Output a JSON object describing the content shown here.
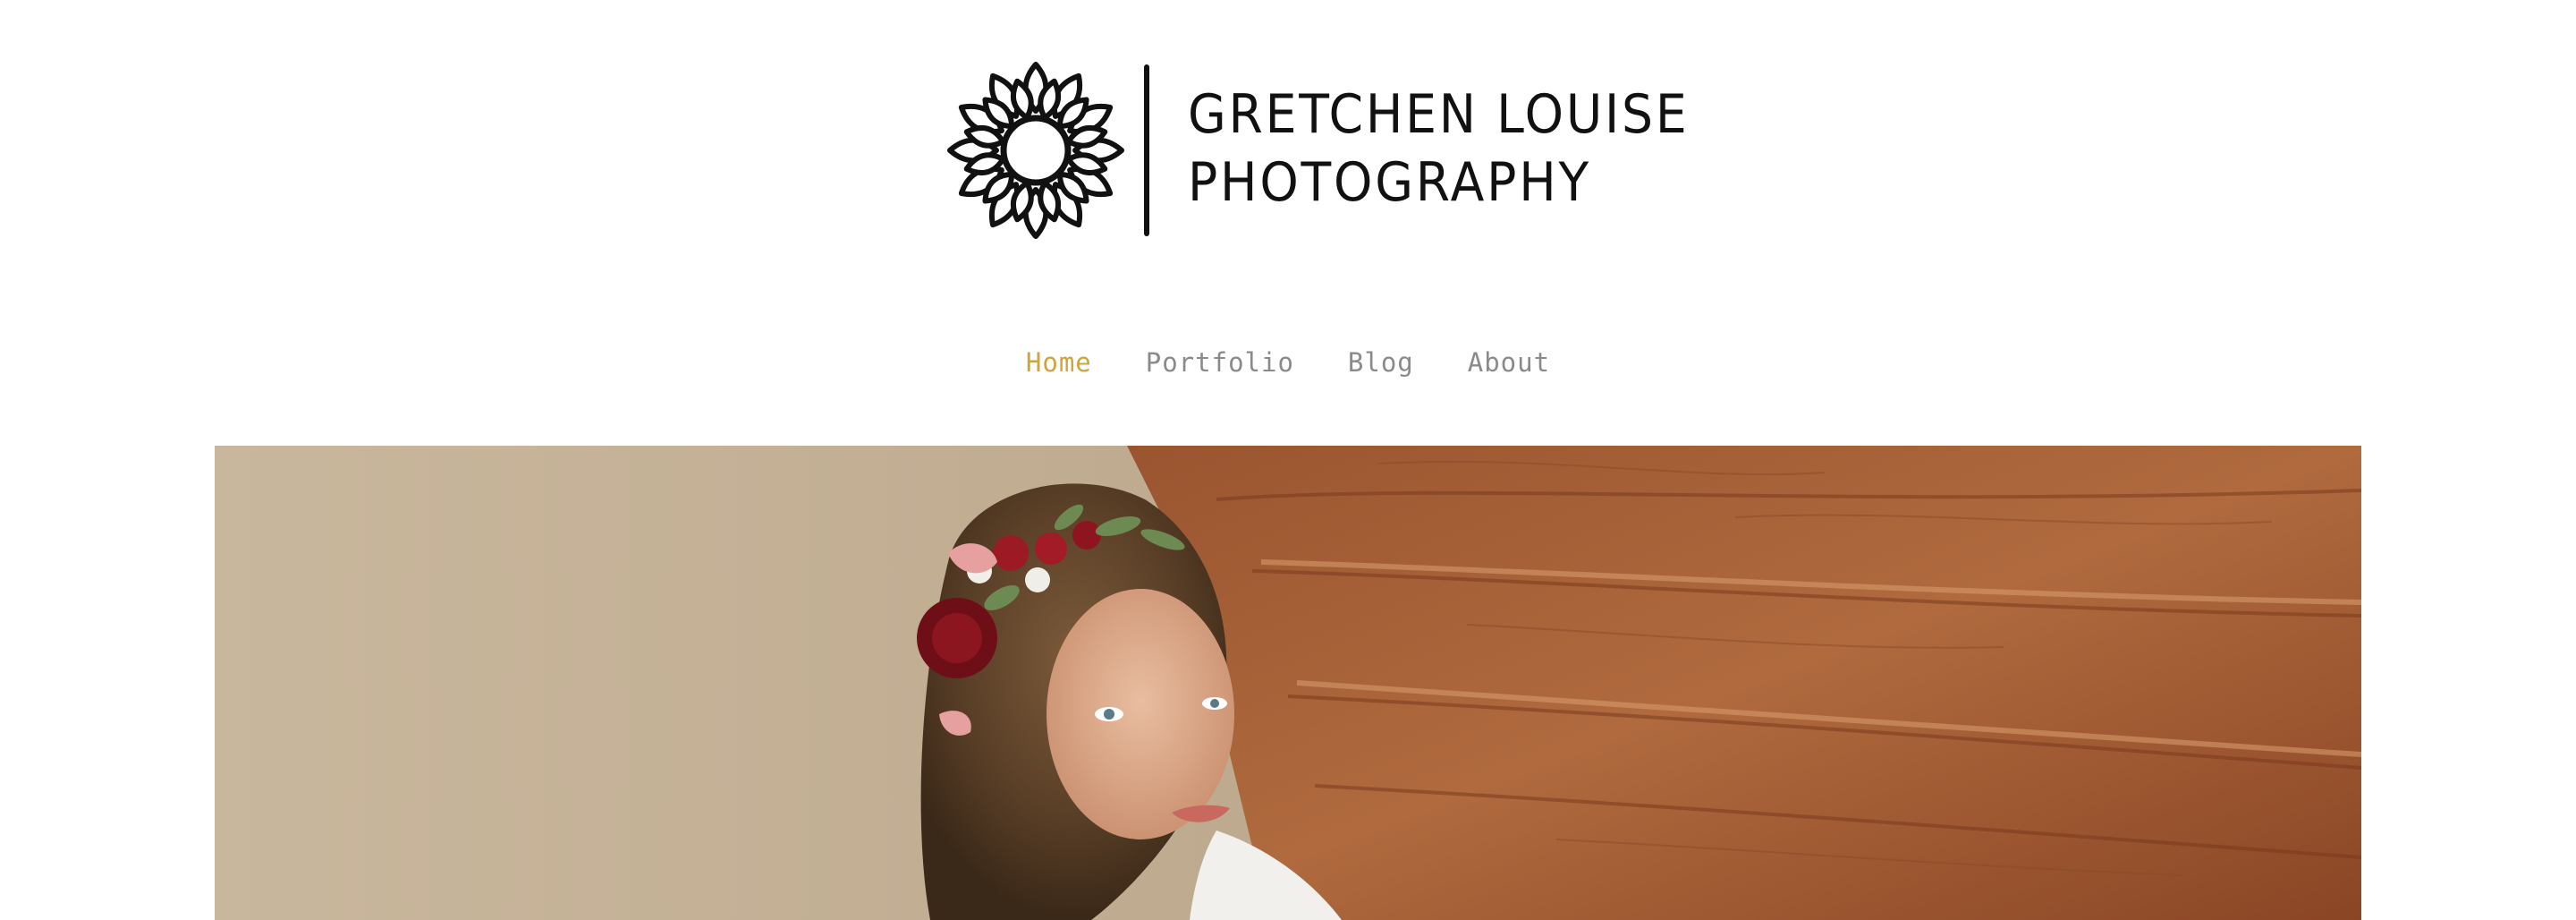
{
  "brand": {
    "line1": "GRETCHEN LOUISE",
    "line2": "PHOTOGRAPHY",
    "logo_icon": "sunflower-icon"
  },
  "nav": {
    "items": [
      {
        "label": "Home",
        "active": true
      },
      {
        "label": "Portfolio",
        "active": false
      },
      {
        "label": "Blog",
        "active": false
      },
      {
        "label": "About",
        "active": false
      }
    ],
    "active_color": "#cda53a",
    "color": "#8a8a8a"
  },
  "hero": {
    "subject": "portrait-photo"
  }
}
